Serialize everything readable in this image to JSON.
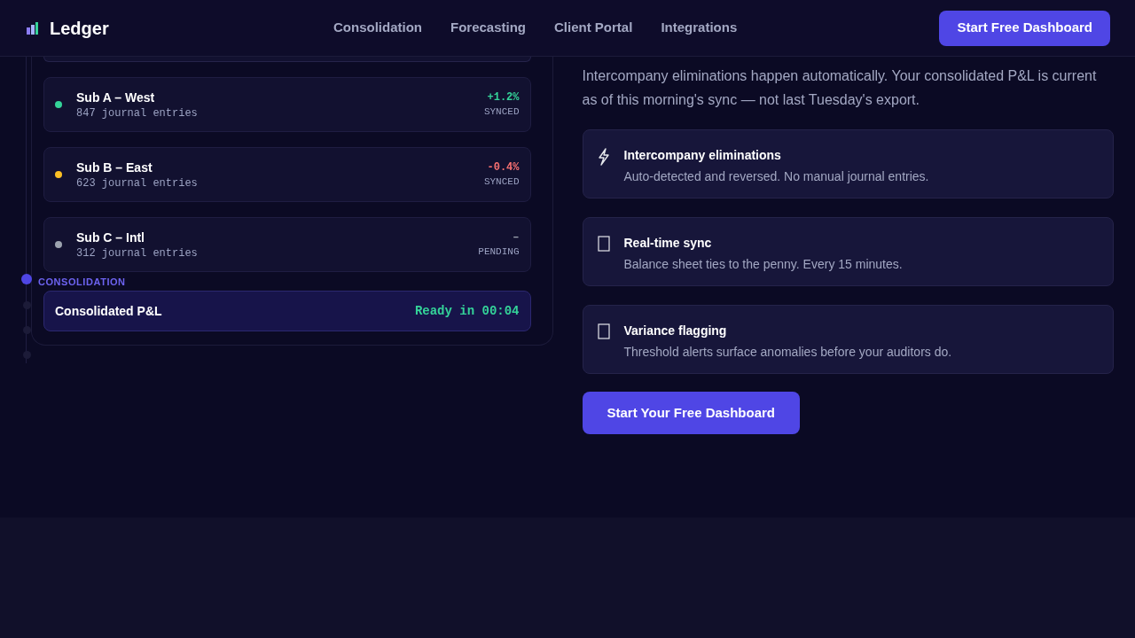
{
  "header": {
    "brand": "Ledger",
    "nav": [
      "Consolidation",
      "Forecasting",
      "Client Portal",
      "Integrations"
    ],
    "cta": "Start Free Dashboard"
  },
  "pipeline": {
    "subsidiaries": [
      {
        "name": "Sub A – West",
        "entries": "847 journal entries",
        "change": "+1.2%",
        "kind": "up",
        "status": "SYNCED",
        "color": "#34d399"
      },
      {
        "name": "Sub B – East",
        "entries": "623 journal entries",
        "change": "-0.4%",
        "kind": "down",
        "status": "SYNCED",
        "color": "#fbbf24"
      },
      {
        "name": "Sub C – Intl",
        "entries": "312 journal entries",
        "change": "–",
        "kind": "none",
        "status": "PENDING",
        "color": "#9ca3af"
      }
    ],
    "stage_label": "CONSOLIDATION",
    "result": {
      "title": "Consolidated P&L",
      "eta": "Ready in 00:04"
    },
    "timeline_steps": [
      {
        "selected": true
      },
      {
        "selected": false
      },
      {
        "selected": false
      },
      {
        "selected": false
      }
    ]
  },
  "intro": "Intercompany eliminations happen automatically. Your consolidated P&L is current as of this morning's sync — not last Tuesday's export.",
  "features": [
    {
      "kind": "bolt",
      "title": "Intercompany eliminations",
      "text": "Auto-detected and reversed. No manual journal entries."
    },
    {
      "kind": "box",
      "title": "Real-time sync",
      "text": "Balance sheet ties to the penny. Every 15 minutes."
    },
    {
      "kind": "box",
      "title": "Variance flagging",
      "text": "Threshold alerts surface anomalies before your auditors do."
    }
  ],
  "cta": "Start Your Free Dashboard"
}
